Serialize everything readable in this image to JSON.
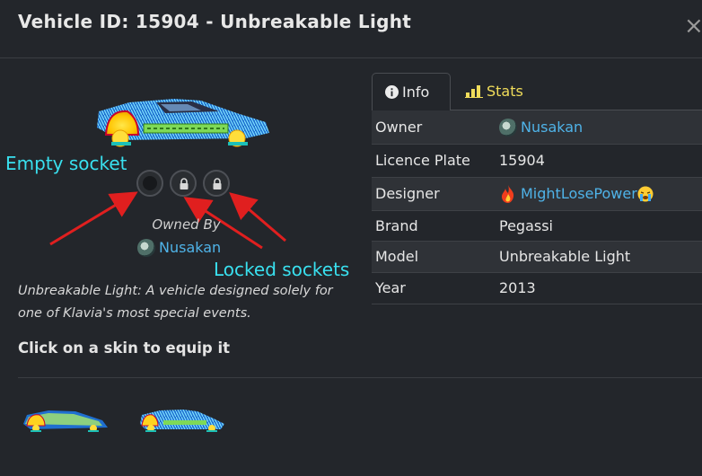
{
  "header": {
    "title": "Vehicle ID: 15904 - Unbreakable Light",
    "close_glyph": "×"
  },
  "vehicle": {
    "owned_by_label": "Owned By",
    "owner": "Nusakan",
    "description": "Unbreakable Light: A vehicle designed solely for one of Klavia's most special events.",
    "equip_prompt": "Click on a skin to equip it"
  },
  "annotations": {
    "empty_socket": "Empty socket",
    "locked_sockets": "Locked sockets"
  },
  "tabs": [
    {
      "label": "Info",
      "icon": "info-circle-icon",
      "active": true
    },
    {
      "label": "Stats",
      "icon": "bar-chart-icon",
      "active": false
    }
  ],
  "info_rows": [
    {
      "key": "Owner",
      "value": "Nusakan"
    },
    {
      "key": "Licence Plate",
      "value": "15904"
    },
    {
      "key": "Designer",
      "value": "MightLosePower"
    },
    {
      "key": "Brand",
      "value": "Pegassi"
    },
    {
      "key": "Model",
      "value": "Unbreakable Light"
    },
    {
      "key": "Year",
      "value": "2013"
    }
  ],
  "colors": {
    "accent_link": "#4fb3e8",
    "annotation": "#39e0ef",
    "stats_tab": "#f0dc5a",
    "arrow": "#e01f1f"
  }
}
